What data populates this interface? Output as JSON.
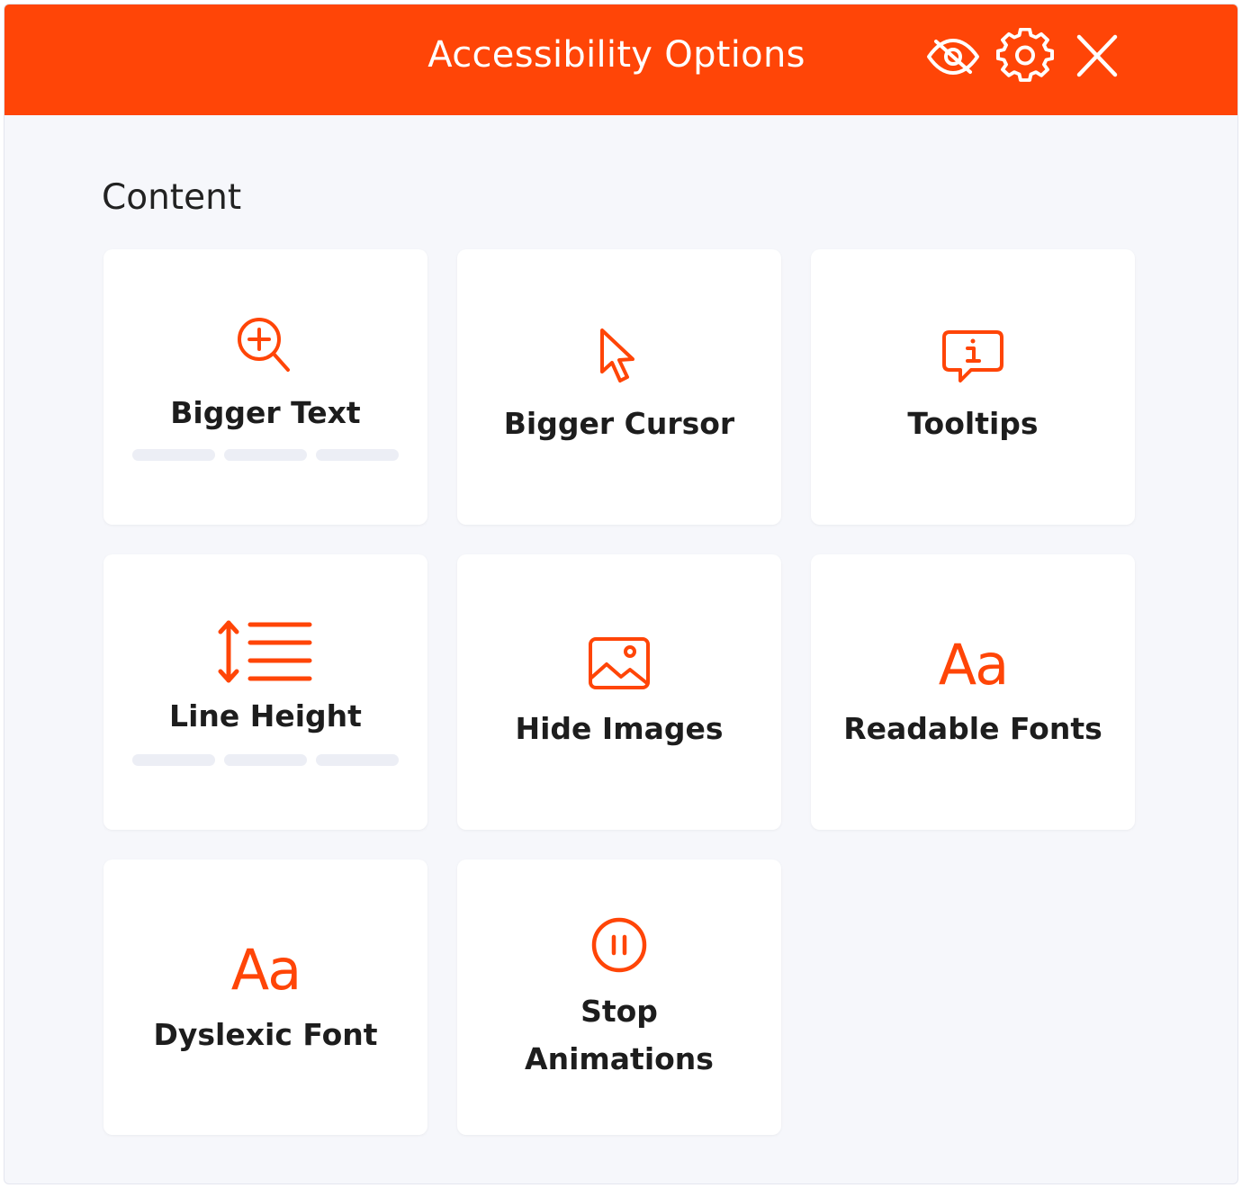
{
  "header": {
    "title": "Accessibility Options",
    "icons": [
      "eye-slash-icon",
      "gear-icon",
      "close-icon"
    ],
    "background_color": "#ff4507"
  },
  "section": {
    "title": "Content"
  },
  "cards": [
    {
      "label": "Bigger Text",
      "icon": "zoom-in-icon",
      "levels": 3,
      "active_levels": 0
    },
    {
      "label": "Bigger Cursor",
      "icon": "cursor-icon"
    },
    {
      "label": "Tooltips",
      "icon": "info-tooltip-icon"
    },
    {
      "label": "Line Height",
      "icon": "line-height-icon",
      "levels": 3,
      "active_levels": 0
    },
    {
      "label": "Hide Images",
      "icon": "image-icon"
    },
    {
      "label": "Readable Fonts",
      "icon": "font-icon",
      "glyph": "Aa"
    },
    {
      "label": "Dyslexic Font",
      "icon": "font-icon",
      "glyph": "Aa"
    },
    {
      "label": "Stop",
      "label_line2": "Animations",
      "icon": "pause-icon"
    }
  ],
  "colors": {
    "accent": "#ff4507",
    "panel_background": "#f6f7fb",
    "card_background": "#ffffff",
    "level_inactive": "#eceef5",
    "text": "#1d1d1d"
  }
}
